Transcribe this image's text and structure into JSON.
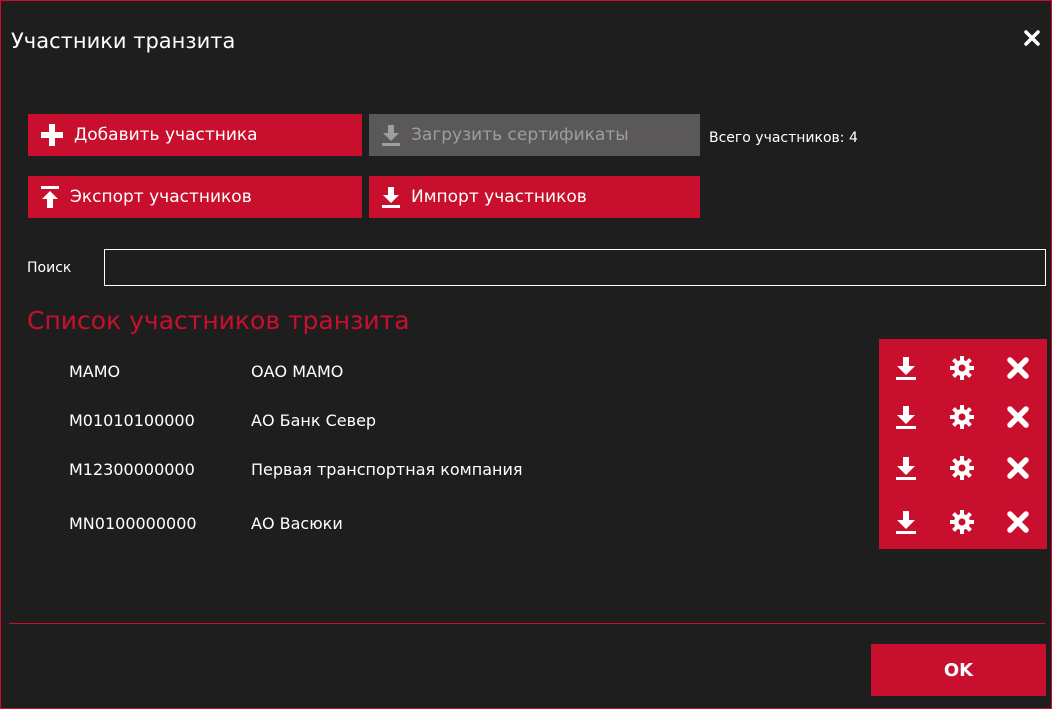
{
  "window": {
    "title": "Участники транзита"
  },
  "toolbar": {
    "add_label": "Добавить участника",
    "load_certs_label": "Загрузить сертификаты",
    "export_label": "Экспорт участников",
    "import_label": "Импорт участников",
    "total_label": "Всего участников: 4"
  },
  "search": {
    "label": "Поиск",
    "value": "",
    "placeholder": ""
  },
  "list": {
    "title": "Список участников транзита",
    "items": [
      {
        "code": "MAMO",
        "name": "ОАО МАМО"
      },
      {
        "code": "M01010100000",
        "name": "АО Банк Север"
      },
      {
        "code": "M12300000000",
        "name": "Первая транспортная компания"
      },
      {
        "code": "MN0100000000",
        "name": "АО Васюки"
      }
    ],
    "row_actions": [
      "download-icon",
      "gear-icon",
      "close-icon"
    ]
  },
  "footer": {
    "ok_label": "OK"
  },
  "colors": {
    "accent": "#c8102e",
    "background": "#1e1e1e",
    "disabled": "#5a5858"
  }
}
